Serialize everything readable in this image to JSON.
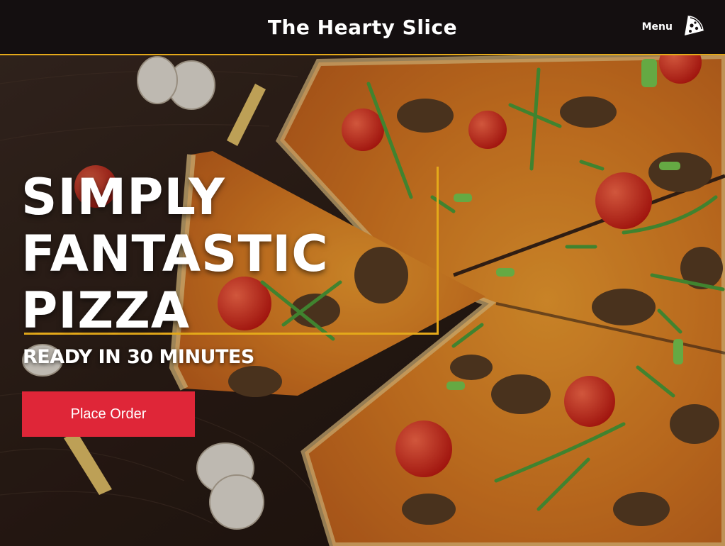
{
  "header": {
    "brand": "The Hearty Slice",
    "menu_label": "Menu",
    "menu_icon": "pizza-slice-icon"
  },
  "hero": {
    "headline_lines": [
      "SIMPLY",
      "FANTASTIC",
      "PIZZA"
    ],
    "subline": "READY IN 30 MINUTES",
    "cta_label": "Place Order",
    "background_image": "pizza-on-wooden-table"
  },
  "colors": {
    "header_bg": "#140f10",
    "accent_gold": "#e4a91a",
    "cta_red": "#df2638",
    "text": "#ffffff"
  }
}
